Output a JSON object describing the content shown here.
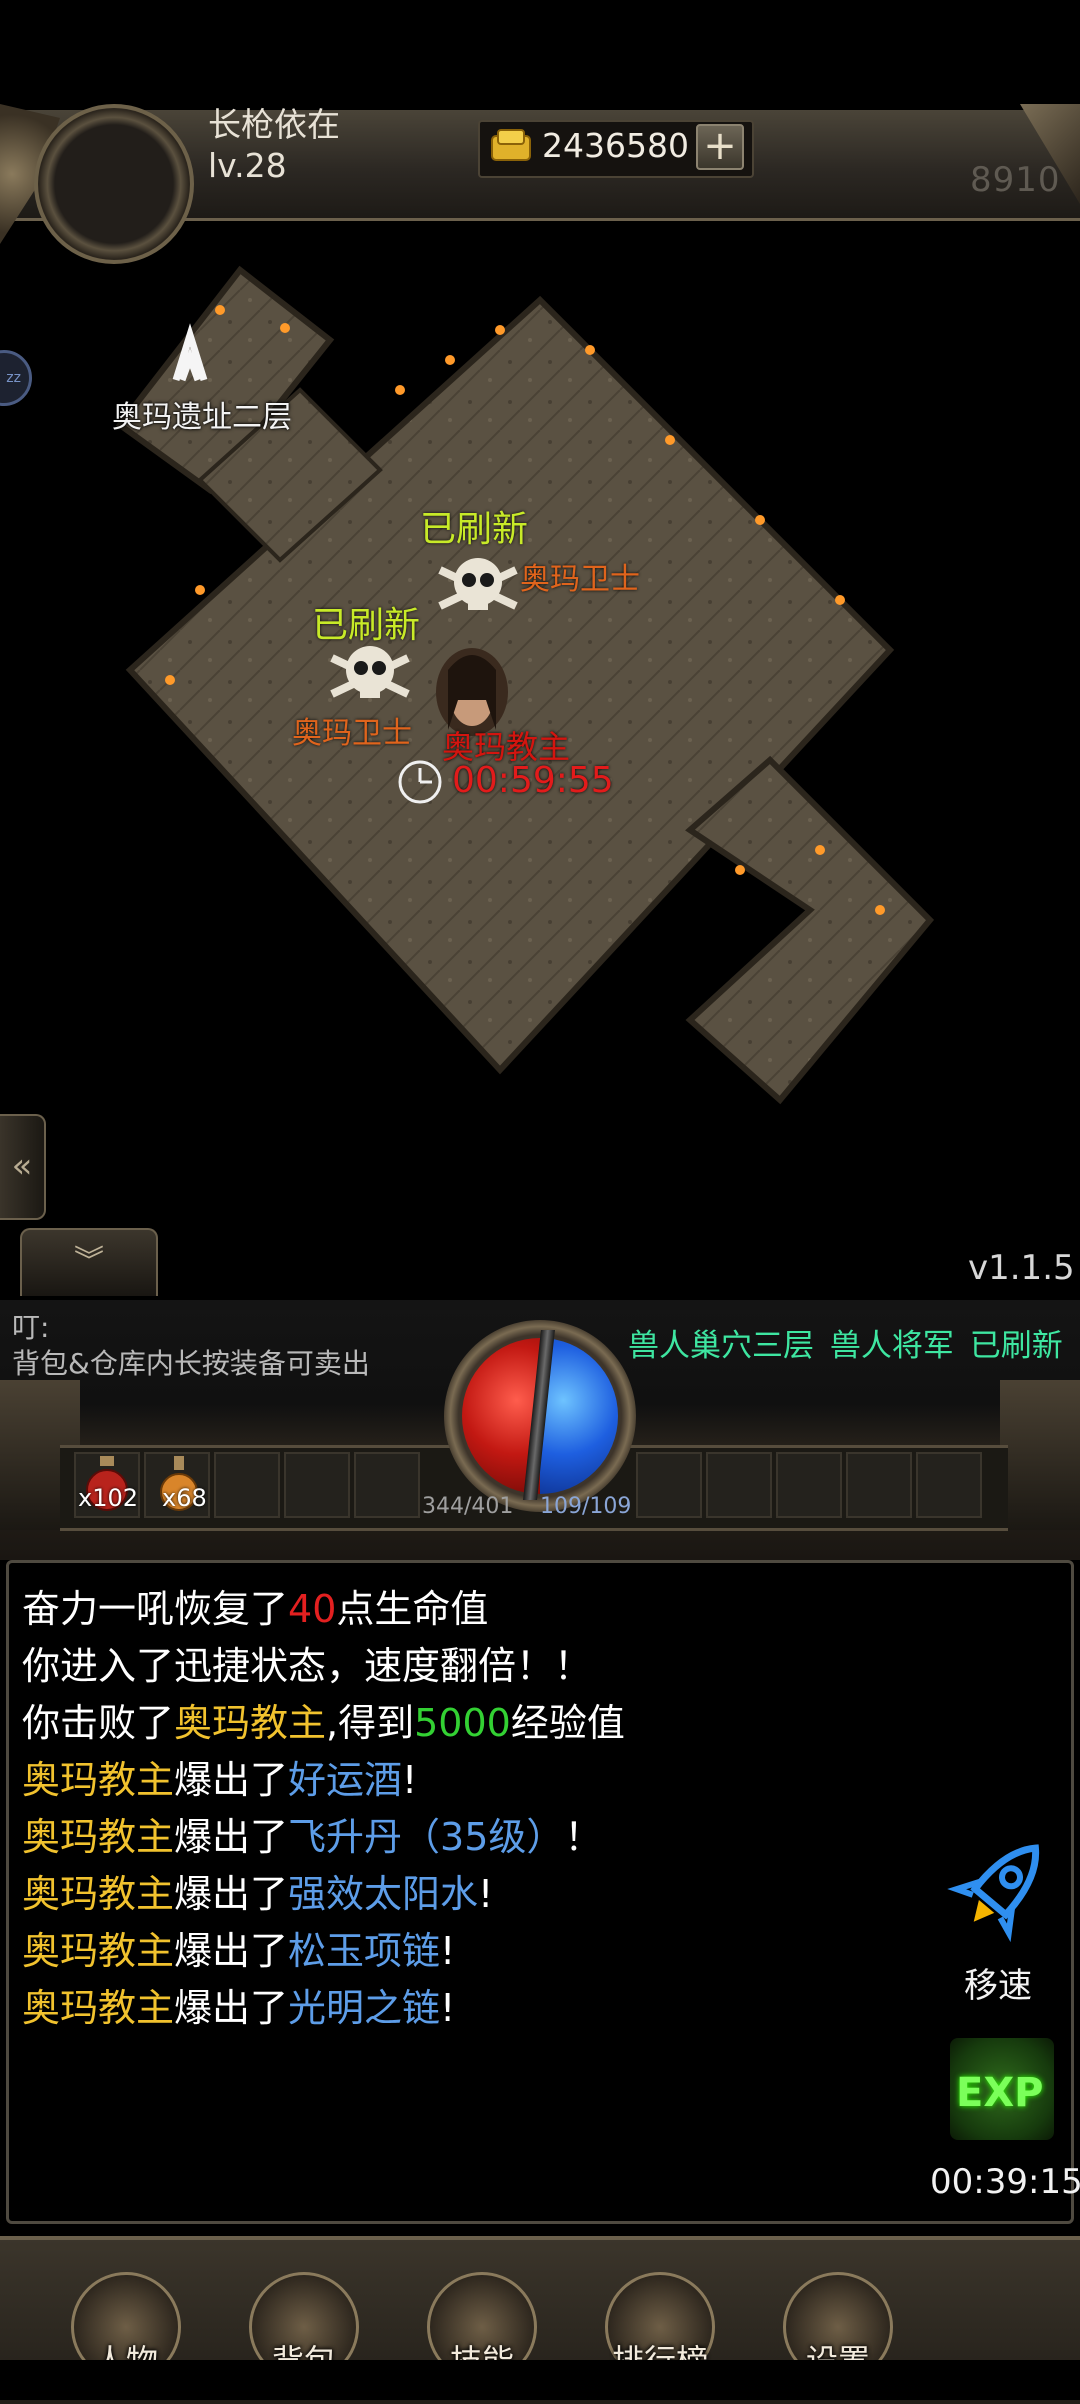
{
  "header": {
    "player_name": "长枪依在",
    "level": "lv.28",
    "gold": "2436580",
    "gold_add": "+",
    "power": "8910"
  },
  "map": {
    "exit_label": "奥玛遗址二层",
    "refresh_1": "已刷新",
    "refresh_2": "已刷新",
    "guard_1": "奥玛卫士",
    "guard_2": "奥玛卫士",
    "boss_name": "奥玛教主",
    "boss_timer": "00:59:55",
    "side_bubble": "zz",
    "version": "v1.1.5"
  },
  "notice": {
    "title": "叮:",
    "text": "背包&仓库内长按装备可卖出",
    "boss_location": "兽人巢穴三层",
    "boss_name": "兽人将军",
    "boss_status": "已刷新"
  },
  "vitals": {
    "hp": "344/401",
    "mp": "109/109"
  },
  "belt": {
    "potion_1_count": "x102",
    "potion_2_count": "x68"
  },
  "chat": [
    {
      "parts": [
        {
          "t": "奋力一吼恢复了",
          "c": "white"
        },
        {
          "t": "40",
          "c": "red"
        },
        {
          "t": "点生命值",
          "c": "white"
        }
      ]
    },
    {
      "parts": [
        {
          "t": "你进入了迅捷状态，速度翻倍！！",
          "c": "white"
        }
      ]
    },
    {
      "parts": [
        {
          "t": "你击败了",
          "c": "white"
        },
        {
          "t": "奥玛教主",
          "c": "yellow"
        },
        {
          "t": ",得到",
          "c": "white"
        },
        {
          "t": "5000",
          "c": "green"
        },
        {
          "t": "经验值",
          "c": "white"
        }
      ]
    },
    {
      "parts": [
        {
          "t": "奥玛教主",
          "c": "yellow"
        },
        {
          "t": "爆出了",
          "c": "white"
        },
        {
          "t": "好运酒",
          "c": "blue"
        },
        {
          "t": "!",
          "c": "white"
        }
      ]
    },
    {
      "parts": [
        {
          "t": "奥玛教主",
          "c": "yellow"
        },
        {
          "t": "爆出了",
          "c": "white"
        },
        {
          "t": "飞升丹（35级）",
          "c": "blue"
        },
        {
          "t": "！",
          "c": "white"
        }
      ]
    },
    {
      "parts": [
        {
          "t": "奥玛教主",
          "c": "yellow"
        },
        {
          "t": "爆出了",
          "c": "white"
        },
        {
          "t": "强效太阳水",
          "c": "blue"
        },
        {
          "t": "!",
          "c": "white"
        }
      ]
    },
    {
      "parts": [
        {
          "t": "奥玛教主",
          "c": "yellow"
        },
        {
          "t": "爆出了",
          "c": "white"
        },
        {
          "t": "松玉项链",
          "c": "blue"
        },
        {
          "t": "!",
          "c": "white"
        }
      ]
    },
    {
      "parts": [
        {
          "t": "奥玛教主",
          "c": "yellow"
        },
        {
          "t": "爆出了",
          "c": "white"
        },
        {
          "t": "光明之链",
          "c": "blue"
        },
        {
          "t": "!",
          "c": "white"
        }
      ]
    }
  ],
  "side_actions": {
    "speed_label": "移速",
    "exp_label": "EXP",
    "exp_timer": "00:39:15"
  },
  "menu": [
    {
      "label": "人物",
      "icon": "character-icon"
    },
    {
      "label": "背包",
      "icon": "backpack-icon"
    },
    {
      "label": "技能",
      "icon": "skills-icon"
    },
    {
      "label": "排行榜",
      "icon": "ranking-icon"
    },
    {
      "label": "设置",
      "icon": "settings-icon"
    }
  ],
  "colors": {
    "refresh": "#c8ea28",
    "guard": "#e0641c",
    "boss": "#d3150f",
    "item": "#5d9de8",
    "exp": "#33d133"
  }
}
